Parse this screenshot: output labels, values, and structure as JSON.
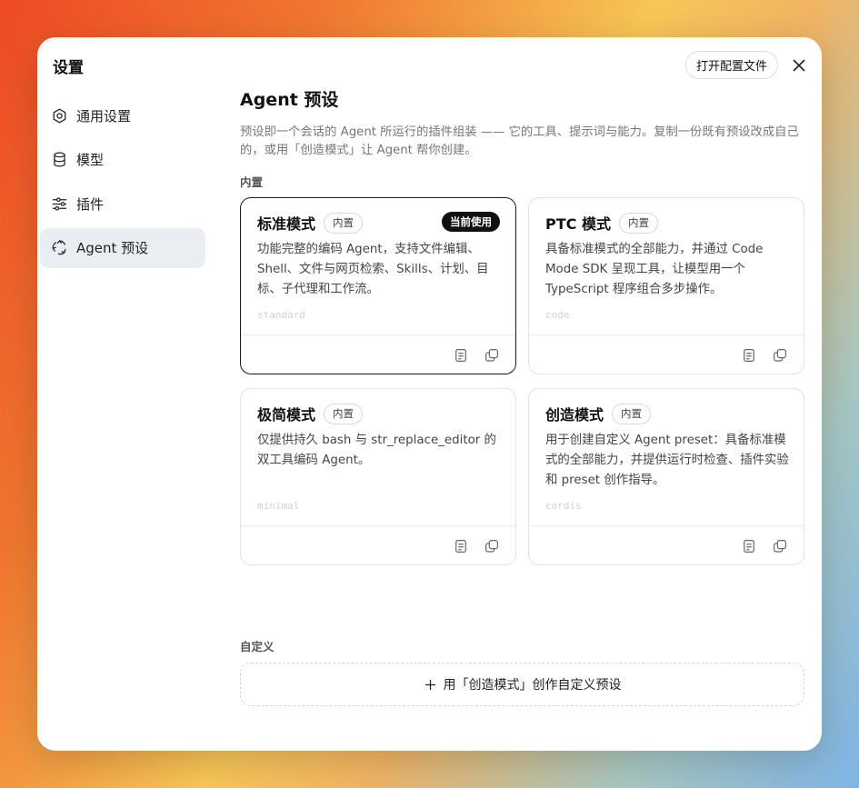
{
  "dialog": {
    "title": "设置",
    "open_config_label": "打开配置文件"
  },
  "sidebar": {
    "items": [
      {
        "label": "通用设置",
        "icon": "gear-icon",
        "active": false
      },
      {
        "label": "模型",
        "icon": "database-icon",
        "active": false
      },
      {
        "label": "插件",
        "icon": "sliders-icon",
        "active": false
      },
      {
        "label": "Agent 预设",
        "icon": "recycle-icon",
        "active": true
      }
    ]
  },
  "main": {
    "title": "Agent 预设",
    "description": "预设即一个会话的 Agent 所运行的插件组装 —— 它的工具、提示词与能力。复制一份既有预设改成自己的，或用「创造模式」让 Agent 帮你创建。",
    "builtin_label": "内置",
    "custom_label": "自定义",
    "create_custom_label": "用「创造模式」创作自定义预设"
  },
  "presets": [
    {
      "name": "标准模式",
      "badge": "内置",
      "current_badge": "当前使用",
      "current": true,
      "description": "功能完整的编码 Agent，支持文件编辑、Shell、文件与网页检索、Skills、计划、目标、子代理和工作流。",
      "id": "standard"
    },
    {
      "name": "PTC 模式",
      "badge": "内置",
      "current": false,
      "description": "具备标准模式的全部能力，并通过 Code Mode SDK 呈现工具，让模型用一个 TypeScript 程序组合多步操作。",
      "id": "code"
    },
    {
      "name": "极简模式",
      "badge": "内置",
      "current": false,
      "description": "仅提供持久 bash 与 str_replace_editor 的双工具编码 Agent。",
      "id": "minimal"
    },
    {
      "name": "创造模式",
      "badge": "内置",
      "current": false,
      "description": "用于创建自定义 Agent preset：具备标准模式的全部能力，并提供运行时检查、插件实验和 preset 创作指导。",
      "id": "cordis"
    }
  ],
  "colors": {
    "accent": "#111111",
    "active_nav_bg": "#eaedf1",
    "muted_text": "#777777"
  }
}
